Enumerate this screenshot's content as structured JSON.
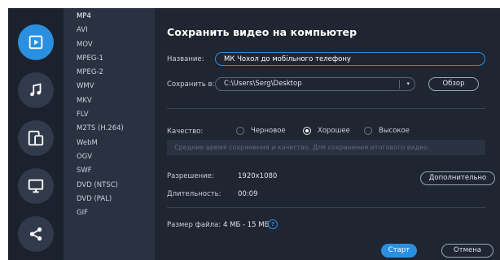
{
  "sidebar": {
    "items": [
      {
        "icon": "video-icon",
        "active": true
      },
      {
        "icon": "music-icon",
        "active": false
      },
      {
        "icon": "devices-icon",
        "active": false
      },
      {
        "icon": "monitor-icon",
        "active": false
      },
      {
        "icon": "share-icon",
        "active": false
      }
    ]
  },
  "formats": [
    "MP4",
    "AVI",
    "MOV",
    "MPEG-1",
    "MPEG-2",
    "WMV",
    "MKV",
    "FLV",
    "M2TS (H.264)",
    "WebM",
    "OGV",
    "SWF",
    "DVD (NTSC)",
    "DVD (PAL)",
    "GIF"
  ],
  "selected_format": "MP4",
  "dialog": {
    "title": "Сохранить видео на компьютер",
    "name_label": "Название:",
    "name_value": "МК Чохол до мобільного телефону",
    "save_label": "Сохранить в:",
    "save_path": "C:\\Users\\Serg\\Desktop",
    "browse_label": "Обзор",
    "quality_label": "Качество:",
    "quality_options": [
      "Черновое",
      "Хорошее",
      "Высокое"
    ],
    "quality_selected": "Хорошее",
    "hint": "Средние время сохранения и качество. Для сохранения итогового видео.",
    "resolution_label": "Разрешение:",
    "resolution_value": "1920x1080",
    "more_label": "Дополнительно",
    "duration_label": "Длительность:",
    "duration_value": "00:09",
    "size_label": "Размер файла:",
    "size_value": "4 МБ - 15 МБ",
    "help_glyph": "?",
    "start_label": "Старт",
    "cancel_label": "Отмена"
  },
  "colors": {
    "accent": "#2b8fe0",
    "background": "#1f2531",
    "format_panel": "#2a3242",
    "icon_bar": "#1c222d"
  }
}
